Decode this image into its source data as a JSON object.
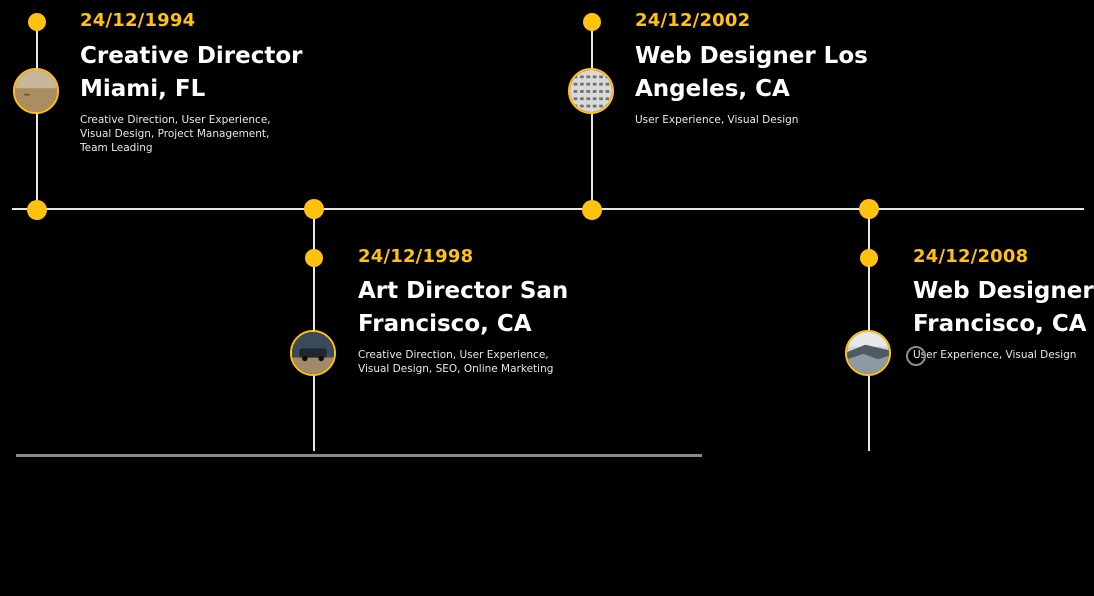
{
  "timeline": {
    "entries": [
      {
        "date": "24/12/1994",
        "title_line1": "Creative Director",
        "title_line2": "Miami, FL",
        "description": "Creative Direction, User Experience, Visual Design, Project Management, Team Leading",
        "image_icon": "desert-landscape-photo"
      },
      {
        "date": "24/12/1998",
        "title_line1": "Art Director San",
        "title_line2": "Francisco, CA",
        "description": "Creative Direction, User Experience, Visual Design, SEO, Online Marketing",
        "image_icon": "car-photo"
      },
      {
        "date": "24/12/2002",
        "title_line1": "Web Designer Los",
        "title_line2": "Angeles, CA",
        "description": "User Experience, Visual Design",
        "image_icon": "building-photo"
      },
      {
        "date": "24/12/2008",
        "title_line1": "Web Designer San",
        "title_line2": "Francisco, CA",
        "description": "User Experience, Visual Design",
        "image_icon": "coastline-photo"
      }
    ]
  },
  "colors": {
    "background": "#000000",
    "accent": "#ffc20e",
    "line": "#e6e6e6",
    "text": "#ffffff"
  }
}
